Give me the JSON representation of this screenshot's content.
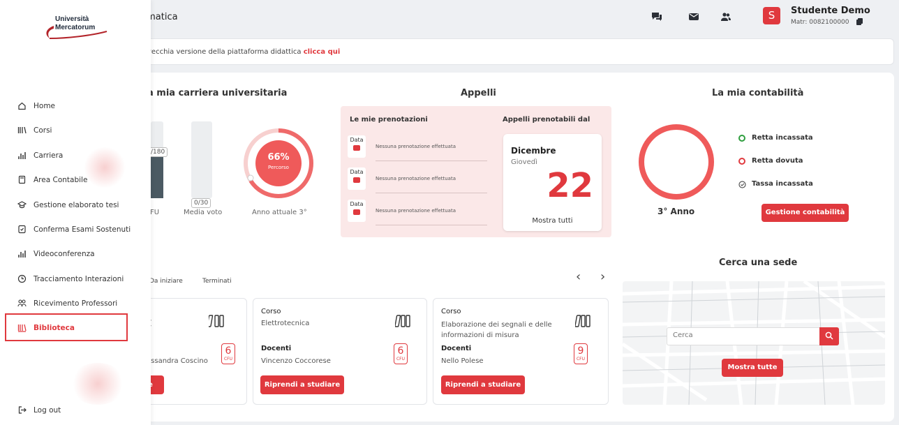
{
  "header": {
    "title": "rmatica",
    "user_name": "Studente Demo",
    "user_matr": "Matr: 0082100000",
    "avatar_initial": "S",
    "icons": [
      "chat-icon",
      "mail-icon",
      "users-icon"
    ]
  },
  "notice": {
    "text": "vecchia versione della piattaforma didattica",
    "link": "clicca qui"
  },
  "carriera": {
    "title": "a mia carriera universitaria",
    "cfu_tag": "/180",
    "cfu_label": "FU",
    "cfu_fraction": 0.55,
    "media_tag": "0/30",
    "media_label": "Media voto",
    "percent": "66%",
    "percent_label": "Percorso",
    "percent_value": 0.66,
    "anno": "Anno attuale 3°"
  },
  "appelli": {
    "title": "Appelli",
    "prenotazioni_head": "Le mie prenotazioni",
    "prenotabili_head": "Appelli prenotabili dal",
    "rows": [
      {
        "date": "Data",
        "text": "Nessuna prenotazione effettuata"
      },
      {
        "date": "Data",
        "text": "Nessuna prenotazione effettuata"
      },
      {
        "date": "Data",
        "text": "Nessuna prenotazione effettuata"
      }
    ],
    "month": "Dicembre",
    "weekday": "Giovedì",
    "day": "22",
    "more": "Mostra tutti"
  },
  "contabilita": {
    "title": "La mia contabilità",
    "anno": "3° Anno",
    "legend": [
      {
        "label": "Retta incassata",
        "color": "#2e9e3e"
      },
      {
        "label": "Retta dovuta",
        "color": "#e0393e"
      },
      {
        "label": "Tassa incassata",
        "color": "#555555"
      }
    ],
    "button": "Gestione contabilità"
  },
  "corsi": {
    "tabs": [
      "Da iniziare",
      "Terminati"
    ],
    "cards": [
      {
        "corso_label": "",
        "corso": "[",
        "docenti_label": "",
        "docenti": "essandra Coscino",
        "cfu": "6",
        "cfu_label": "CFU",
        "button": "e"
      },
      {
        "corso_label": "Corso",
        "corso": "Elettrotecnica",
        "docenti_label": "Docenti",
        "docenti": "Vincenzo Coccorese",
        "cfu": "6",
        "cfu_label": "CFU",
        "button": "Riprendi a studiare"
      },
      {
        "corso_label": "Corso",
        "corso": "Elaborazione dei segnali e delle informazioni di misura",
        "docenti_label": "Docenti",
        "docenti": "Nello Polese",
        "cfu": "9",
        "cfu_label": "CFU",
        "button": "Riprendi a studiare"
      }
    ]
  },
  "sede": {
    "title": "Cerca una sede",
    "search_placeholder": "Cerca",
    "button": "Mostra tutte"
  },
  "sidebar": {
    "logo_line1": "Università",
    "logo_line2": "Mercatorum",
    "items": [
      {
        "label": "Home",
        "icon": "home-icon"
      },
      {
        "label": "Corsi",
        "icon": "books-icon"
      },
      {
        "label": "Carriera",
        "icon": "chart-icon"
      },
      {
        "label": "Area Contabile",
        "icon": "calculator-icon"
      },
      {
        "label": "Gestione elaborato tesi",
        "icon": "graduation-cap-icon"
      },
      {
        "label": "Conferma Esami Sostenuti",
        "icon": "check-document-icon"
      },
      {
        "label": "Videoconferenza",
        "icon": "video-icon"
      },
      {
        "label": "Tracciamento Interazioni",
        "icon": "clock-icon"
      },
      {
        "label": "Ricevimento Professori",
        "icon": "people-icon"
      },
      {
        "label": "Biblioteca",
        "icon": "library-icon"
      }
    ],
    "logout": "Log out"
  }
}
